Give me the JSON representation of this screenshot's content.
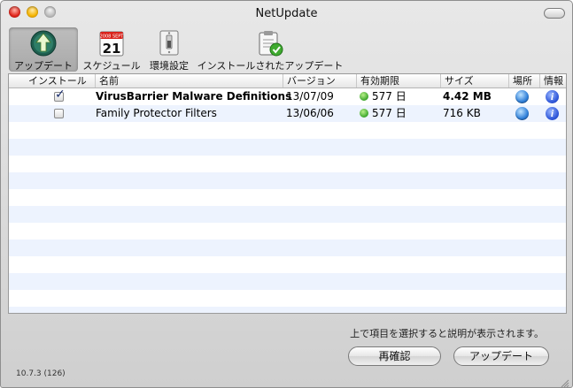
{
  "window": {
    "title": "NetUpdate"
  },
  "toolbar": {
    "items": [
      {
        "label": "アップデート",
        "icon": "update-arrow-icon",
        "selected": true
      },
      {
        "label": "スケジュール",
        "icon": "calendar-icon",
        "selected": false,
        "calendar_day": "21",
        "calendar_banner": "2008 SEPT"
      },
      {
        "label": "環境設定",
        "icon": "switch-icon",
        "selected": false
      },
      {
        "label": "インストールされたアップデート",
        "icon": "clipboard-check-icon",
        "selected": false
      }
    ]
  },
  "table": {
    "headers": {
      "install": "インストール",
      "name": "名前",
      "version": "バージョン",
      "validity": "有効期限",
      "size": "サイズ",
      "location": "場所",
      "info": "情報"
    },
    "rows": [
      {
        "install": true,
        "name": "VirusBarrier Malware Definitions",
        "version": "13/07/09",
        "validity": "577 日",
        "size": "4.42 MB",
        "bold": true
      },
      {
        "install": false,
        "name": "Family Protector Filters",
        "version": "13/06/06",
        "validity": "577 日",
        "size": "716 KB",
        "bold": false
      }
    ],
    "status_color": "#3aa52a"
  },
  "footer": {
    "hint": "上で項目を選択すると説明が表示されます。",
    "recheck_button": "再確認",
    "update_button": "アップデート",
    "version": "10.7.3 (126)"
  }
}
